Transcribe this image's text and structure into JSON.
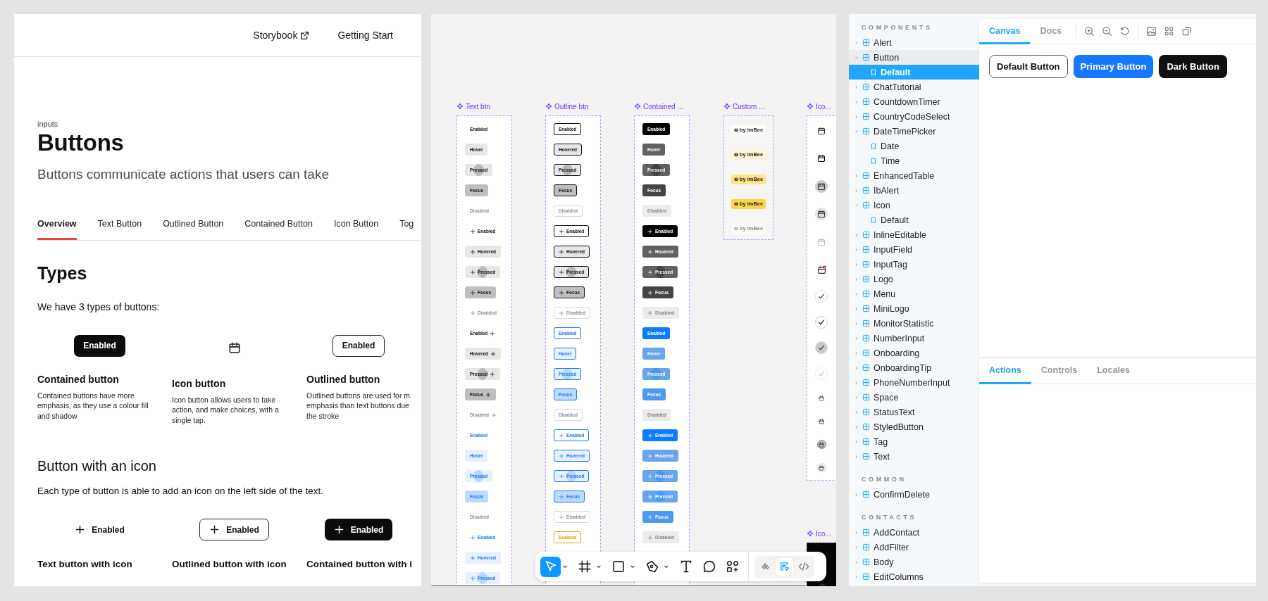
{
  "docs": {
    "nav": [
      {
        "label": "Storybook",
        "external": true
      },
      {
        "label": "Getting Start",
        "external": false
      }
    ],
    "category": "inputs",
    "title": "Buttons",
    "subtitle": "Buttons communicate actions that users can take",
    "tabs": [
      {
        "label": "Overview",
        "selected": true
      },
      {
        "label": "Text Button",
        "selected": false
      },
      {
        "label": "Outlined Button",
        "selected": false
      },
      {
        "label": "Contained Button",
        "selected": false
      },
      {
        "label": "Icon Button",
        "selected": false
      },
      {
        "label": "Tog",
        "selected": false
      }
    ],
    "types_heading": "Types",
    "types_intro": "We have 3 types of buttons:",
    "types": [
      {
        "kind": "contained",
        "button": "Enabled",
        "title": "Contained button",
        "description": [
          "Contained buttons have more",
          "emphasis, as they use a colour fill",
          "and shadow"
        ]
      },
      {
        "kind": "icon",
        "title": "Icon button",
        "description": [
          "Icon button allows users to take",
          "action, and make choices, with a",
          "single tap."
        ]
      },
      {
        "kind": "outlined",
        "button": "Enabled",
        "title": "Outlined button",
        "description": [
          "Outlined buttons are used for m",
          "emphasis than text buttons due",
          "the stroke"
        ]
      }
    ],
    "icon_heading": "Button with an icon",
    "icon_intro": "Each type of button is able to add an icon on the left side of the text.",
    "icon_examples": [
      {
        "kind": "text",
        "button": "Enabled",
        "caption": "Text button with icon"
      },
      {
        "kind": "outlined",
        "button": "Enabled",
        "caption": "Outlined button with icon"
      },
      {
        "kind": "contained",
        "button": "Enabled",
        "caption": "Contained button with i"
      }
    ]
  },
  "design_canvas": {
    "frames": [
      {
        "title": "Text btn",
        "kind": "text",
        "rows": [
          {
            "label": "Enabled",
            "kind": "neutral",
            "leading_icon": false,
            "trailing_icon": false,
            "hovered": false,
            "pressed": false,
            "focused": false,
            "disabled": false
          },
          {
            "label": "Hover",
            "kind": "neutral",
            "leading_icon": false,
            "trailing_icon": false,
            "hovered": true,
            "pressed": false,
            "focused": false,
            "disabled": false
          },
          {
            "label": "Pressed",
            "kind": "neutral",
            "leading_icon": false,
            "trailing_icon": false,
            "hovered": false,
            "pressed": true,
            "focused": false,
            "disabled": false
          },
          {
            "label": "Focus",
            "kind": "neutral",
            "leading_icon": false,
            "trailing_icon": false,
            "hovered": false,
            "pressed": false,
            "focused": true,
            "disabled": false
          },
          {
            "label": "Disabled",
            "kind": "neutral",
            "leading_icon": false,
            "trailing_icon": false,
            "hovered": false,
            "pressed": false,
            "focused": false,
            "disabled": true
          },
          {
            "label": "Enabled",
            "kind": "neutral",
            "leading_icon": true,
            "trailing_icon": false,
            "hovered": false,
            "pressed": false,
            "focused": false,
            "disabled": false
          },
          {
            "label": "Hovered",
            "kind": "neutral",
            "leading_icon": true,
            "trailing_icon": false,
            "hovered": true,
            "pressed": false,
            "focused": false,
            "disabled": false
          },
          {
            "label": "Pressed",
            "kind": "neutral",
            "leading_icon": true,
            "trailing_icon": false,
            "hovered": false,
            "pressed": true,
            "focused": false,
            "disabled": false
          },
          {
            "label": "Focus",
            "kind": "neutral",
            "leading_icon": true,
            "trailing_icon": false,
            "hovered": false,
            "pressed": false,
            "focused": true,
            "disabled": false
          },
          {
            "label": "Disabled",
            "kind": "neutral",
            "leading_icon": true,
            "trailing_icon": false,
            "hovered": false,
            "pressed": false,
            "focused": false,
            "disabled": true
          },
          {
            "label": "Enabled",
            "kind": "neutral",
            "leading_icon": false,
            "trailing_icon": true,
            "hovered": false,
            "pressed": false,
            "focused": false,
            "disabled": false
          },
          {
            "label": "Hovered",
            "kind": "neutral",
            "leading_icon": false,
            "trailing_icon": true,
            "hovered": true,
            "pressed": false,
            "focused": false,
            "disabled": false
          },
          {
            "label": "Pressed",
            "kind": "neutral",
            "leading_icon": false,
            "trailing_icon": true,
            "hovered": false,
            "pressed": true,
            "focused": false,
            "disabled": false
          },
          {
            "label": "Focus",
            "kind": "neutral",
            "leading_icon": false,
            "trailing_icon": true,
            "hovered": false,
            "pressed": false,
            "focused": true,
            "disabled": false
          },
          {
            "label": "Disabled",
            "kind": "neutral",
            "leading_icon": false,
            "trailing_icon": true,
            "hovered": false,
            "pressed": false,
            "focused": false,
            "disabled": true
          },
          {
            "label": "Enabled",
            "kind": "primary",
            "leading_icon": false,
            "trailing_icon": false,
            "hovered": false,
            "pressed": false,
            "focused": false,
            "disabled": false
          },
          {
            "label": "Hover",
            "kind": "primary",
            "leading_icon": false,
            "trailing_icon": false,
            "hovered": true,
            "pressed": false,
            "focused": false,
            "disabled": false
          },
          {
            "label": "Pressed",
            "kind": "primary",
            "leading_icon": false,
            "trailing_icon": false,
            "hovered": false,
            "pressed": true,
            "focused": false,
            "disabled": false
          },
          {
            "label": "Focus",
            "kind": "primary",
            "leading_icon": false,
            "trailing_icon": false,
            "hovered": false,
            "pressed": false,
            "focused": true,
            "disabled": false
          },
          {
            "label": "Disabled",
            "kind": "primary",
            "leading_icon": false,
            "trailing_icon": false,
            "hovered": false,
            "pressed": false,
            "focused": false,
            "disabled": true
          },
          {
            "label": "Enabled",
            "kind": "primary",
            "leading_icon": true,
            "trailing_icon": false,
            "hovered": false,
            "pressed": false,
            "focused": false,
            "disabled": false
          },
          {
            "label": "Hovered",
            "kind": "primary",
            "leading_icon": true,
            "trailing_icon": false,
            "hovered": true,
            "pressed": false,
            "focused": false,
            "disabled": false
          },
          {
            "label": "Pressed",
            "kind": "primary",
            "leading_icon": true,
            "trailing_icon": false,
            "hovered": false,
            "pressed": true,
            "focused": false,
            "disabled": false
          }
        ]
      },
      {
        "title": "Outline btn",
        "kind": "outline",
        "rows": [
          {
            "label": "Enabled",
            "kind": "neutral",
            "leading_icon": false,
            "trailing_icon": false,
            "hovered": false,
            "pressed": false,
            "focused": false,
            "disabled": false
          },
          {
            "label": "Hovered",
            "kind": "neutral",
            "leading_icon": false,
            "trailing_icon": false,
            "hovered": true,
            "pressed": false,
            "focused": false,
            "disabled": false
          },
          {
            "label": "Pressed",
            "kind": "neutral",
            "leading_icon": false,
            "trailing_icon": false,
            "hovered": false,
            "pressed": true,
            "focused": false,
            "disabled": false
          },
          {
            "label": "Focus",
            "kind": "neutral",
            "leading_icon": false,
            "trailing_icon": false,
            "hovered": false,
            "pressed": false,
            "focused": true,
            "disabled": false
          },
          {
            "label": "Disabled",
            "kind": "neutral",
            "leading_icon": false,
            "trailing_icon": false,
            "hovered": false,
            "pressed": false,
            "focused": false,
            "disabled": true
          },
          {
            "label": "Enabled",
            "kind": "neutral",
            "leading_icon": true,
            "trailing_icon": false,
            "hovered": false,
            "pressed": false,
            "focused": false,
            "disabled": false
          },
          {
            "label": "Hovered",
            "kind": "neutral",
            "leading_icon": true,
            "trailing_icon": false,
            "hovered": true,
            "pressed": false,
            "focused": false,
            "disabled": false
          },
          {
            "label": "Pressed",
            "kind": "neutral",
            "leading_icon": true,
            "trailing_icon": false,
            "hovered": false,
            "pressed": true,
            "focused": false,
            "disabled": false
          },
          {
            "label": "Focus",
            "kind": "neutral",
            "leading_icon": true,
            "trailing_icon": false,
            "hovered": false,
            "pressed": false,
            "focused": true,
            "disabled": false
          },
          {
            "label": "Disabled",
            "kind": "neutral",
            "leading_icon": true,
            "trailing_icon": false,
            "hovered": false,
            "pressed": false,
            "focused": false,
            "disabled": true
          },
          {
            "label": "Enabled",
            "kind": "primary",
            "leading_icon": false,
            "trailing_icon": false,
            "hovered": false,
            "pressed": false,
            "focused": false,
            "disabled": false
          },
          {
            "label": "Hover",
            "kind": "primary",
            "leading_icon": false,
            "trailing_icon": false,
            "hovered": true,
            "pressed": false,
            "focused": false,
            "disabled": false
          },
          {
            "label": "Pressed",
            "kind": "primary",
            "leading_icon": false,
            "trailing_icon": false,
            "hovered": false,
            "pressed": true,
            "focused": false,
            "disabled": false
          },
          {
            "label": "Focus",
            "kind": "primary",
            "leading_icon": false,
            "trailing_icon": false,
            "hovered": false,
            "pressed": false,
            "focused": true,
            "disabled": false
          },
          {
            "label": "Disabled",
            "kind": "primary",
            "leading_icon": false,
            "trailing_icon": false,
            "hovered": false,
            "pressed": false,
            "focused": false,
            "disabled": true
          },
          {
            "label": "Enabled",
            "kind": "primary",
            "leading_icon": true,
            "trailing_icon": false,
            "hovered": false,
            "pressed": false,
            "focused": false,
            "disabled": false
          },
          {
            "label": "Hovered",
            "kind": "primary",
            "leading_icon": true,
            "trailing_icon": false,
            "hovered": true,
            "pressed": false,
            "focused": false,
            "disabled": false
          },
          {
            "label": "Pressed",
            "kind": "primary",
            "leading_icon": true,
            "trailing_icon": false,
            "hovered": false,
            "pressed": true,
            "focused": false,
            "disabled": false
          },
          {
            "label": "Focus",
            "kind": "primary",
            "leading_icon": true,
            "trailing_icon": false,
            "hovered": false,
            "pressed": false,
            "focused": true,
            "disabled": false
          },
          {
            "label": "Disabled",
            "kind": "primary",
            "leading_icon": true,
            "trailing_icon": false,
            "hovered": false,
            "pressed": false,
            "focused": false,
            "disabled": true
          },
          {
            "label": "Enabled",
            "kind": "warning",
            "leading_icon": false,
            "trailing_icon": false,
            "hovered": false,
            "pressed": false,
            "focused": false,
            "disabled": false
          }
        ]
      },
      {
        "title": "Contained ...",
        "kind": "contained",
        "rows": [
          {
            "label": "Enabled",
            "kind": "neutral",
            "leading_icon": false,
            "trailing_icon": false,
            "hovered": false,
            "pressed": false,
            "focused": false,
            "disabled": false
          },
          {
            "label": "Hover",
            "kind": "neutral",
            "leading_icon": false,
            "trailing_icon": false,
            "hovered": true,
            "pressed": false,
            "focused": false,
            "disabled": false
          },
          {
            "label": "Pressed",
            "kind": "neutral",
            "leading_icon": false,
            "trailing_icon": false,
            "hovered": false,
            "pressed": true,
            "focused": false,
            "disabled": false
          },
          {
            "label": "Focus",
            "kind": "neutral",
            "leading_icon": false,
            "trailing_icon": false,
            "hovered": false,
            "pressed": false,
            "focused": true,
            "disabled": false
          },
          {
            "label": "Disabled",
            "kind": "neutral",
            "leading_icon": false,
            "trailing_icon": false,
            "hovered": false,
            "pressed": false,
            "focused": false,
            "disabled": true
          },
          {
            "label": "Enabled",
            "kind": "neutral",
            "leading_icon": true,
            "trailing_icon": false,
            "hovered": false,
            "pressed": false,
            "focused": false,
            "disabled": false
          },
          {
            "label": "Hovered",
            "kind": "neutral",
            "leading_icon": true,
            "trailing_icon": false,
            "hovered": true,
            "pressed": false,
            "focused": false,
            "disabled": false
          },
          {
            "label": "Pressed",
            "kind": "neutral",
            "leading_icon": true,
            "trailing_icon": false,
            "hovered": false,
            "pressed": true,
            "focused": false,
            "disabled": false
          },
          {
            "label": "Focus",
            "kind": "neutral",
            "leading_icon": true,
            "trailing_icon": false,
            "hovered": false,
            "pressed": false,
            "focused": true,
            "disabled": false
          },
          {
            "label": "Disabled",
            "kind": "neutral",
            "leading_icon": true,
            "trailing_icon": false,
            "hovered": false,
            "pressed": false,
            "focused": false,
            "disabled": true
          },
          {
            "label": "Enabled",
            "kind": "primary",
            "leading_icon": false,
            "trailing_icon": false,
            "hovered": false,
            "pressed": false,
            "focused": false,
            "disabled": false
          },
          {
            "label": "Hover",
            "kind": "primary",
            "leading_icon": false,
            "trailing_icon": false,
            "hovered": true,
            "pressed": false,
            "focused": false,
            "disabled": false
          },
          {
            "label": "Pressed",
            "kind": "primary",
            "leading_icon": false,
            "trailing_icon": false,
            "hovered": false,
            "pressed": true,
            "focused": false,
            "disabled": false
          },
          {
            "label": "Focus",
            "kind": "primary",
            "leading_icon": false,
            "trailing_icon": false,
            "hovered": false,
            "pressed": false,
            "focused": true,
            "disabled": false
          },
          {
            "label": "Disabled",
            "kind": "primary",
            "leading_icon": false,
            "trailing_icon": false,
            "hovered": false,
            "pressed": false,
            "focused": false,
            "disabled": true
          },
          {
            "label": "Enabled",
            "kind": "primary",
            "leading_icon": true,
            "trailing_icon": false,
            "hovered": false,
            "pressed": false,
            "focused": false,
            "disabled": false
          },
          {
            "label": "Hovered",
            "kind": "primary",
            "leading_icon": true,
            "trailing_icon": false,
            "hovered": true,
            "pressed": false,
            "focused": false,
            "disabled": false
          },
          {
            "label": "Pressed",
            "kind": "primary",
            "leading_icon": true,
            "trailing_icon": false,
            "hovered": false,
            "pressed": true,
            "focused": false,
            "disabled": false
          },
          {
            "label": "Pressed",
            "kind": "primary",
            "leading_icon": true,
            "trailing_icon": false,
            "hovered": false,
            "pressed": true,
            "focused": false,
            "disabled": false
          },
          {
            "label": "Focus",
            "kind": "primary",
            "leading_icon": true,
            "trailing_icon": false,
            "hovered": false,
            "pressed": false,
            "focused": true,
            "disabled": false
          },
          {
            "label": "Disabled",
            "kind": "primary",
            "leading_icon": true,
            "trailing_icon": false,
            "hovered": false,
            "pressed": false,
            "focused": false,
            "disabled": true
          }
        ]
      },
      {
        "title": "Custom ...",
        "kind": "custom",
        "chips": [
          {
            "label": "by imBee",
            "hovered": false,
            "pressed": false,
            "focused": false,
            "disabled": false
          },
          {
            "label": "by imBee",
            "hovered": true,
            "pressed": false,
            "focused": false,
            "disabled": false
          },
          {
            "label": "by imBee",
            "hovered": false,
            "pressed": true,
            "focused": false,
            "disabled": false
          },
          {
            "label": "by imBee",
            "hovered": false,
            "pressed": false,
            "focused": true,
            "disabled": false
          },
          {
            "label": "by imBee",
            "hovered": false,
            "pressed": false,
            "focused": false,
            "disabled": true
          }
        ]
      },
      {
        "title": "Ico...",
        "kind": "icon",
        "icons": [
          {
            "kind": "calendar",
            "hovered": false,
            "pressed": false,
            "focused": false,
            "disabled": false
          },
          {
            "kind": "calendar",
            "hovered": true,
            "pressed": false,
            "focused": false,
            "disabled": false
          },
          {
            "kind": "calendar",
            "hovered": false,
            "pressed": true,
            "focused": false,
            "disabled": false
          },
          {
            "kind": "calendar",
            "hovered": false,
            "pressed": false,
            "focused": true,
            "disabled": false
          },
          {
            "kind": "calendar",
            "hovered": false,
            "pressed": false,
            "focused": false,
            "disabled": true
          },
          {
            "kind": "badged",
            "hovered": false,
            "pressed": false,
            "focused": false,
            "disabled": false
          },
          {
            "kind": "check",
            "hovered": false,
            "pressed": false,
            "focused": false,
            "disabled": false
          },
          {
            "kind": "check",
            "hovered": true,
            "pressed": false,
            "focused": false,
            "disabled": false
          },
          {
            "kind": "check",
            "hovered": false,
            "pressed": true,
            "focused": false,
            "disabled": false
          },
          {
            "kind": "check",
            "hovered": false,
            "pressed": false,
            "focused": false,
            "disabled": true
          },
          {
            "kind": "small",
            "hovered": false,
            "pressed": false,
            "focused": false,
            "disabled": false
          },
          {
            "kind": "small",
            "hovered": true,
            "pressed": false,
            "focused": false,
            "disabled": false
          },
          {
            "kind": "small",
            "hovered": false,
            "pressed": true,
            "focused": false,
            "disabled": false
          },
          {
            "kind": "small",
            "hovered": false,
            "pressed": false,
            "focused": true,
            "disabled": false
          }
        ]
      },
      {
        "title": "Ico...",
        "kind": "dark"
      }
    ],
    "toolbar": {
      "tools": [
        {
          "kind": "move",
          "selected": true,
          "has_menu": true
        },
        {
          "kind": "frame",
          "selected": false,
          "has_menu": true
        },
        {
          "kind": "shape",
          "selected": false,
          "has_menu": true
        },
        {
          "kind": "pen",
          "selected": false,
          "has_menu": true
        },
        {
          "kind": "text",
          "selected": false,
          "has_menu": false
        },
        {
          "kind": "comment",
          "selected": false,
          "has_menu": false
        },
        {
          "kind": "components",
          "selected": false,
          "has_menu": false
        }
      ],
      "modes": [
        {
          "kind": "draw",
          "selected": false
        },
        {
          "kind": "design",
          "selected": true
        },
        {
          "kind": "code",
          "selected": false
        }
      ]
    }
  },
  "storybook": {
    "sidebar": {
      "sections": [
        {
          "title": "COMPONENTS",
          "items": [
            {
              "label": "Alert",
              "expanded": false,
              "selected": false
            },
            {
              "label": "Button",
              "expanded": true,
              "selected": false,
              "children": [
                {
                  "label": "Default",
                  "selected": true
                }
              ]
            },
            {
              "label": "ChatTutorial",
              "expanded": false,
              "selected": false
            },
            {
              "label": "CountdownTimer",
              "expanded": false,
              "selected": false
            },
            {
              "label": "CountryCodeSelect",
              "expanded": false,
              "selected": false
            },
            {
              "label": "DateTimePicker",
              "expanded": true,
              "selected": false,
              "children": [
                {
                  "label": "Date",
                  "selected": false
                },
                {
                  "label": "Time",
                  "selected": false
                }
              ]
            },
            {
              "label": "EnhancedTable",
              "expanded": false,
              "selected": false
            },
            {
              "label": "IbAlert",
              "expanded": false,
              "selected": false
            },
            {
              "label": "Icon",
              "expanded": true,
              "selected": false,
              "children": [
                {
                  "label": "Default",
                  "selected": false
                }
              ]
            },
            {
              "label": "InlineEditable",
              "expanded": false,
              "selected": false
            },
            {
              "label": "InputField",
              "expanded": false,
              "selected": false
            },
            {
              "label": "InputTag",
              "expanded": false,
              "selected": false
            },
            {
              "label": "Logo",
              "expanded": false,
              "selected": false
            },
            {
              "label": "Menu",
              "expanded": false,
              "selected": false
            },
            {
              "label": "MiniLogo",
              "expanded": false,
              "selected": false
            },
            {
              "label": "MonitorStatistic",
              "expanded": false,
              "selected": false
            },
            {
              "label": "NumberInput",
              "expanded": false,
              "selected": false
            },
            {
              "label": "Onboarding",
              "expanded": false,
              "selected": false
            },
            {
              "label": "OnboardingTip",
              "expanded": false,
              "selected": false
            },
            {
              "label": "PhoneNumberInput",
              "expanded": false,
              "selected": false
            },
            {
              "label": "Space",
              "expanded": false,
              "selected": false
            },
            {
              "label": "StatusText",
              "expanded": false,
              "selected": false
            },
            {
              "label": "StyledButton",
              "expanded": false,
              "selected": false
            },
            {
              "label": "Tag",
              "expanded": false,
              "selected": false
            },
            {
              "label": "Text",
              "expanded": false,
              "selected": false
            }
          ]
        },
        {
          "title": "COMMON",
          "items": [
            {
              "label": "ConfirmDelete",
              "expanded": false,
              "selected": false
            }
          ]
        },
        {
          "title": "CONTACTS",
          "items": [
            {
              "label": "AddContact",
              "expanded": false,
              "selected": false
            },
            {
              "label": "AddFilter",
              "expanded": false,
              "selected": false
            },
            {
              "label": "Body",
              "expanded": false,
              "selected": false
            },
            {
              "label": "EditColumns",
              "expanded": false,
              "selected": false
            }
          ]
        }
      ]
    },
    "tabs": [
      {
        "label": "Canvas",
        "selected": true
      },
      {
        "label": "Docs",
        "selected": false
      }
    ],
    "preview_buttons": [
      {
        "label": "Default Button",
        "kind": "default"
      },
      {
        "label": "Primary Button",
        "kind": "primary"
      },
      {
        "label": "Dark Button",
        "kind": "dark"
      }
    ],
    "addon_tabs": [
      {
        "label": "Actions",
        "selected": true
      },
      {
        "label": "Controls",
        "selected": false
      },
      {
        "label": "Locales",
        "selected": false
      }
    ]
  }
}
